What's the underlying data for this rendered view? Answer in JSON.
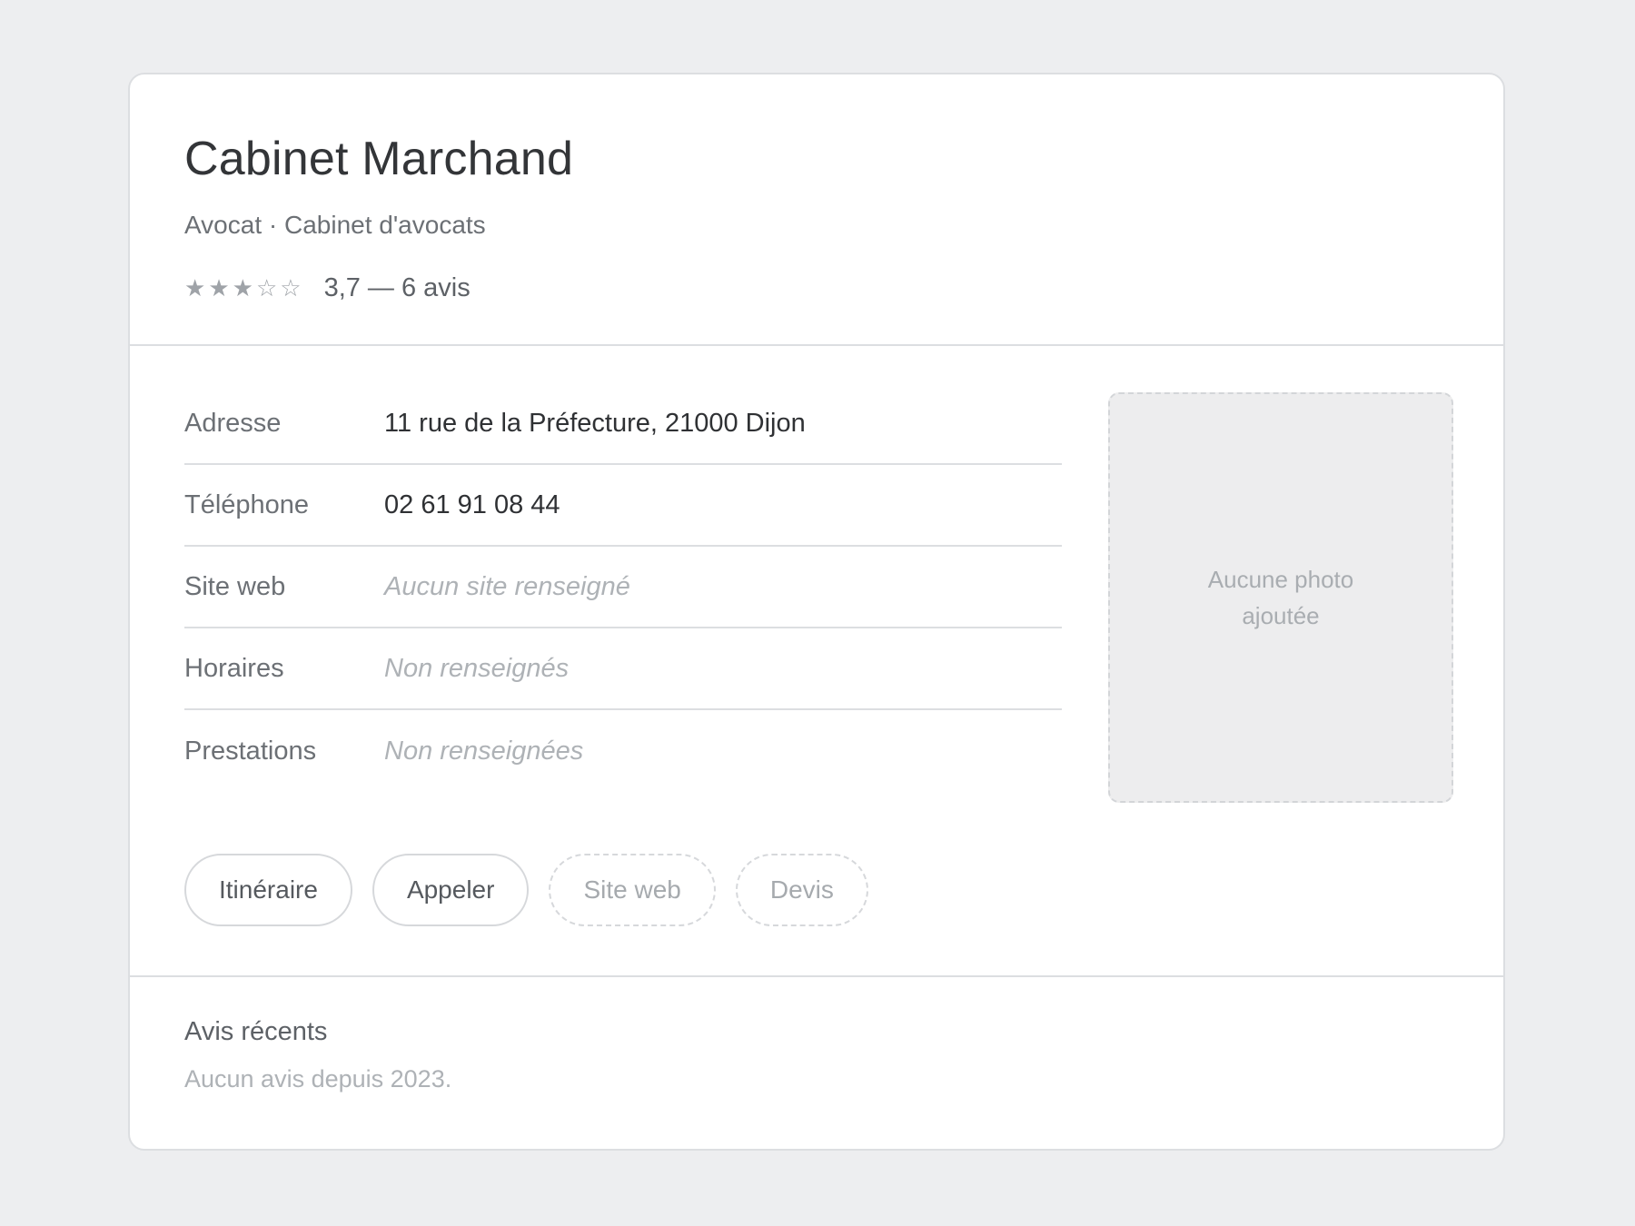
{
  "business": {
    "name": "Cabinet Marchand",
    "category": "Avocat · Cabinet d'avocats",
    "rating": {
      "value": 3.7,
      "stars_filled": 3,
      "stars_total": 5,
      "text": "3,7 — 6 avis",
      "filled_glyph": "★",
      "empty_glyph": "☆"
    }
  },
  "details": [
    {
      "label": "Adresse",
      "value": "11 rue de la Préfecture, 21000 Dijon",
      "empty": false
    },
    {
      "label": "Téléphone",
      "value": "02 61 91 08 44",
      "empty": false
    },
    {
      "label": "Site web",
      "value": "Aucun site renseigné",
      "empty": true
    },
    {
      "label": "Horaires",
      "value": "Non renseignés",
      "empty": true
    },
    {
      "label": "Prestations",
      "value": "Non renseignées",
      "empty": true
    }
  ],
  "photo": {
    "placeholder": "Aucune photo ajoutée"
  },
  "actions": [
    {
      "label": "Itinéraire",
      "enabled": true
    },
    {
      "label": "Appeler",
      "enabled": true
    },
    {
      "label": "Site web",
      "enabled": false
    },
    {
      "label": "Devis",
      "enabled": false
    }
  ],
  "reviews": {
    "title": "Avis récents",
    "empty_text": "Aucun avis depuis 2023."
  },
  "colors": {
    "background": "#edeef0",
    "card": "#ffffff",
    "border": "#dcdee1",
    "star": "#9fa3a8",
    "muted_text": "#aeb2b6"
  }
}
